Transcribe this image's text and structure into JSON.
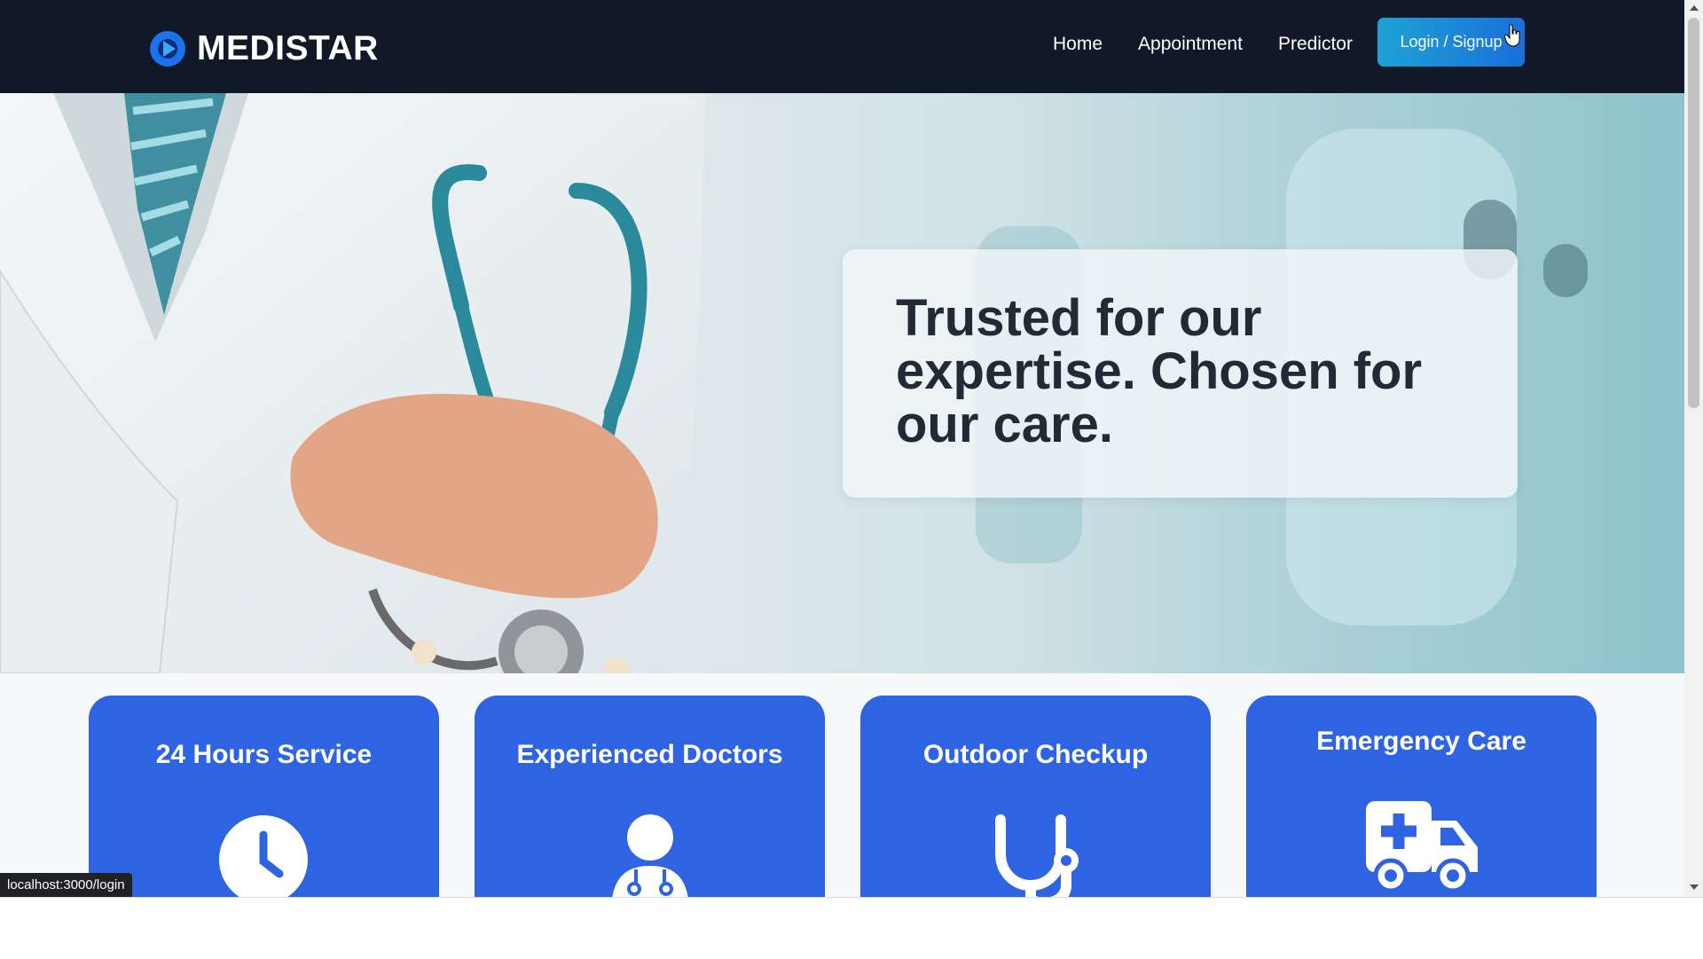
{
  "brand": {
    "name": "MEDISTAR",
    "logo_icon": "medistar-logo-icon",
    "logo_color": "#1a73e8"
  },
  "nav": {
    "links": [
      {
        "label": "Home"
      },
      {
        "label": "Appointment"
      },
      {
        "label": "Predictor"
      }
    ],
    "login_label": "Login / Signup"
  },
  "hero": {
    "heading": "Trusted for our expertise. Chosen for our care."
  },
  "services": [
    {
      "title": "24 Hours Service",
      "icon": "clock-icon"
    },
    {
      "title": "Experienced Doctors",
      "icon": "doctor-icon"
    },
    {
      "title": "Outdoor Checkup",
      "icon": "stethoscope-icon"
    },
    {
      "title": "Emergency Care",
      "icon": "ambulance-icon"
    }
  ],
  "status_bar": {
    "url": "localhost:3000/login"
  },
  "colors": {
    "navbar": "#111827",
    "accent": "#2e63e2",
    "login_gradient_start": "#1ea2d6",
    "login_gradient_end": "#1a6fd8"
  }
}
